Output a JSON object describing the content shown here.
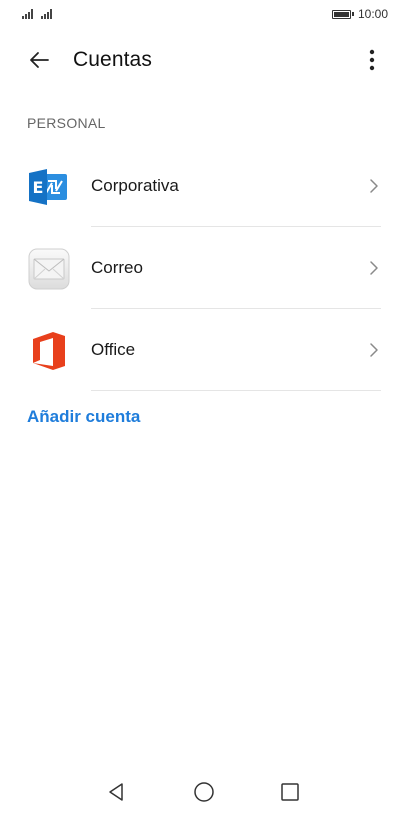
{
  "status_bar": {
    "time": "10:00"
  },
  "app_bar": {
    "title": "Cuentas"
  },
  "section": {
    "header": "PERSONAL"
  },
  "accounts": [
    {
      "label": "Corporativa",
      "icon": "exchange-icon"
    },
    {
      "label": "Correo",
      "icon": "mail-envelope-icon"
    },
    {
      "label": "Office",
      "icon": "office-icon"
    }
  ],
  "actions": {
    "add_account": "Añadir cuenta"
  },
  "colors": {
    "accent": "#1f7ddb",
    "exchange_blue": "#1572c5",
    "office_orange": "#e8401c"
  }
}
